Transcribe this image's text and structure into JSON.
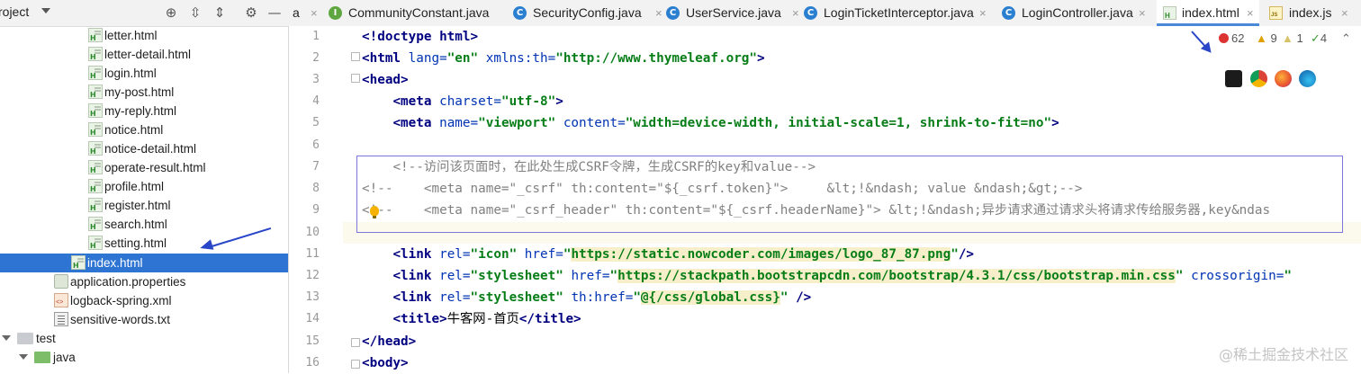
{
  "project_panel": {
    "title": "roject",
    "tree": [
      {
        "label": "letter.html",
        "icon": "html-file-icon"
      },
      {
        "label": "letter-detail.html",
        "icon": "html-file-icon"
      },
      {
        "label": "login.html",
        "icon": "html-file-icon"
      },
      {
        "label": "my-post.html",
        "icon": "html-file-icon"
      },
      {
        "label": "my-reply.html",
        "icon": "html-file-icon"
      },
      {
        "label": "notice.html",
        "icon": "html-file-icon"
      },
      {
        "label": "notice-detail.html",
        "icon": "html-file-icon"
      },
      {
        "label": "operate-result.html",
        "icon": "html-file-icon"
      },
      {
        "label": "profile.html",
        "icon": "html-file-icon"
      },
      {
        "label": "register.html",
        "icon": "html-file-icon"
      },
      {
        "label": "search.html",
        "icon": "html-file-icon"
      },
      {
        "label": "setting.html",
        "icon": "html-file-icon"
      },
      {
        "label": "index.html",
        "icon": "html-file-icon",
        "selected": true
      },
      {
        "label": "application.properties",
        "icon": "properties-file-icon"
      },
      {
        "label": "logback-spring.xml",
        "icon": "xml-file-icon"
      },
      {
        "label": "sensitive-words.txt",
        "icon": "text-file-icon"
      },
      {
        "label": "test",
        "icon": "folder-icon"
      },
      {
        "label": "java",
        "icon": "folder-icon"
      }
    ]
  },
  "tabs": [
    {
      "label": "a"
    },
    {
      "label": "CommunityConstant.java",
      "icon": "interface-icon"
    },
    {
      "label": "SecurityConfig.java",
      "icon": "class-icon"
    },
    {
      "label": "UserService.java",
      "icon": "class-icon"
    },
    {
      "label": "LoginTicketInterceptor.java",
      "icon": "class-icon"
    },
    {
      "label": "LoginController.java",
      "icon": "class-icon"
    },
    {
      "label": "index.html",
      "icon": "html-file-icon",
      "active": true
    },
    {
      "label": "index.js",
      "icon": "js-file-icon"
    }
  ],
  "inspections": {
    "errors": "62",
    "warnings": "9",
    "weak_warnings": "1",
    "typos": "4"
  },
  "line_numbers": [
    "1",
    "2",
    "3",
    "4",
    "5",
    "6",
    "7",
    "8",
    "9",
    "10",
    "11",
    "12",
    "13",
    "14",
    "15",
    "16"
  ],
  "code": {
    "l7": "<!--访问该页面时，在此处生成CSRF令牌，生成CSRF的key和value-->",
    "l8": "<!--    <meta name=\"_csrf\" th:content=\"${_csrf.token}\">     &lt;!&ndash; value &ndash;&gt;-->",
    "l9": "    <meta name=\"_csrf_header\" th:content=\"${_csrf.headerName}\"> &lt;!&ndash;异步请求通过请求头将请求传给服务器,key&ndas",
    "l9_prefix": "<!--",
    "charset": "\"utf-8\"",
    "viewport_name": "\"viewport\"",
    "viewport_content": "\"width=device-width, initial-scale=1, shrink-to-fit=no\"",
    "html_lang": "\"en\"",
    "thymeleaf": "\"http://www.thymeleaf.org\"",
    "icon_href": "https://static.nowcoder.com/images/logo_87_87.png",
    "css_href": "https://stackpath.bootstrapcdn.com/bootstrap/4.3.1/css/bootstrap.min.css",
    "global_css": "@{/css/global.css}",
    "title_text": "牛客网-首页"
  },
  "watermark": "@稀土掘金技术社区"
}
